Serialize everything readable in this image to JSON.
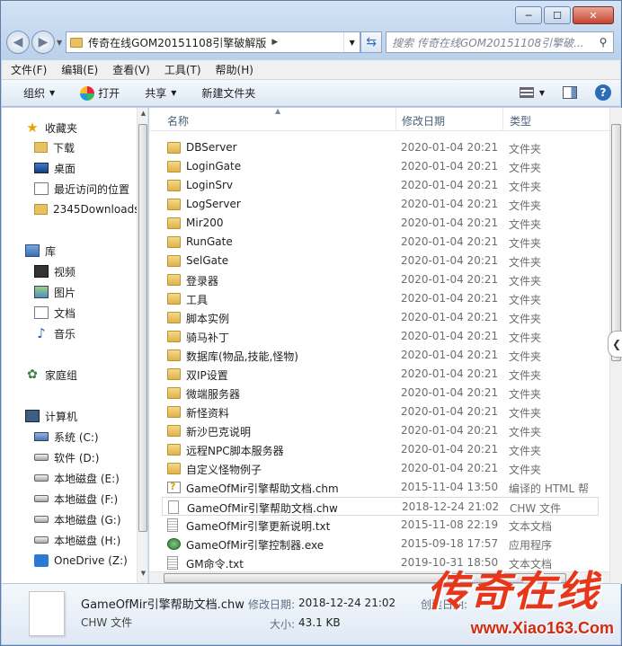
{
  "window": {
    "minimize_label": "─",
    "maximize_label": "☐",
    "close_label": "✕"
  },
  "address": {
    "path_segment": "传奇在线GOM20151108引擎破解版",
    "search_placeholder": "搜索 传奇在线GOM20151108引擎破..."
  },
  "menubar": [
    "文件(F)",
    "编辑(E)",
    "查看(V)",
    "工具(T)",
    "帮助(H)"
  ],
  "toolbar": {
    "organize": "组织",
    "open": "打开",
    "share": "共享",
    "new_folder": "新建文件夹"
  },
  "nav": {
    "favorites": "收藏夹",
    "downloads": "下载",
    "desktop": "桌面",
    "recent": "最近访问的位置",
    "folder_2345": "2345Downloads",
    "libraries": "库",
    "videos": "视频",
    "pictures": "图片",
    "documents": "文档",
    "music": "音乐",
    "homegroup": "家庭组",
    "computer": "计算机",
    "drives": [
      "系统 (C:)",
      "软件 (D:)",
      "本地磁盘 (E:)",
      "本地磁盘 (F:)",
      "本地磁盘 (G:)",
      "本地磁盘 (H:)",
      "OneDrive (Z:)"
    ]
  },
  "columns": {
    "name": "名称",
    "date": "修改日期",
    "type": "类型"
  },
  "files": [
    {
      "name": "DBServer",
      "date": "2020-01-04 20:21",
      "type": "文件夹",
      "icon": "folder-icon"
    },
    {
      "name": "LoginGate",
      "date": "2020-01-04 20:21",
      "type": "文件夹",
      "icon": "folder-icon"
    },
    {
      "name": "LoginSrv",
      "date": "2020-01-04 20:21",
      "type": "文件夹",
      "icon": "folder-icon"
    },
    {
      "name": "LogServer",
      "date": "2020-01-04 20:21",
      "type": "文件夹",
      "icon": "folder-icon"
    },
    {
      "name": "Mir200",
      "date": "2020-01-04 20:21",
      "type": "文件夹",
      "icon": "folder-icon"
    },
    {
      "name": "RunGate",
      "date": "2020-01-04 20:21",
      "type": "文件夹",
      "icon": "folder-icon"
    },
    {
      "name": "SelGate",
      "date": "2020-01-04 20:21",
      "type": "文件夹",
      "icon": "folder-icon"
    },
    {
      "name": "登录器",
      "date": "2020-01-04 20:21",
      "type": "文件夹",
      "icon": "folder-icon"
    },
    {
      "name": "工具",
      "date": "2020-01-04 20:21",
      "type": "文件夹",
      "icon": "folder-icon"
    },
    {
      "name": "脚本实例",
      "date": "2020-01-04 20:21",
      "type": "文件夹",
      "icon": "folder-icon"
    },
    {
      "name": "骑马补丁",
      "date": "2020-01-04 20:21",
      "type": "文件夹",
      "icon": "folder-icon"
    },
    {
      "name": "数据库(物品,技能,怪物)",
      "date": "2020-01-04 20:21",
      "type": "文件夹",
      "icon": "folder-icon"
    },
    {
      "name": "双IP设置",
      "date": "2020-01-04 20:21",
      "type": "文件夹",
      "icon": "folder-icon"
    },
    {
      "name": "微端服务器",
      "date": "2020-01-04 20:21",
      "type": "文件夹",
      "icon": "folder-icon"
    },
    {
      "name": "新怪资料",
      "date": "2020-01-04 20:21",
      "type": "文件夹",
      "icon": "folder-icon"
    },
    {
      "name": "新沙巴克说明",
      "date": "2020-01-04 20:21",
      "type": "文件夹",
      "icon": "folder-icon"
    },
    {
      "name": "远程NPC脚本服务器",
      "date": "2020-01-04 20:21",
      "type": "文件夹",
      "icon": "folder-icon"
    },
    {
      "name": "自定义怪物例子",
      "date": "2020-01-04 20:21",
      "type": "文件夹",
      "icon": "folder-icon"
    },
    {
      "name": "GameOfMir引擎帮助文档.chm",
      "date": "2015-11-04 13:50",
      "type": "编译的 HTML 帮",
      "icon": "chm-icon"
    },
    {
      "name": "GameOfMir引擎帮助文档.chw",
      "date": "2018-12-24 21:02",
      "type": "CHW 文件",
      "icon": "file-icon",
      "selected": true
    },
    {
      "name": "GameOfMir引擎更新说明.txt",
      "date": "2015-11-08 22:19",
      "type": "文本文档",
      "icon": "text-file-icon"
    },
    {
      "name": "GameOfMir引擎控制器.exe",
      "date": "2015-09-18 17:57",
      "type": "应用程序",
      "icon": "exe-icon"
    },
    {
      "name": "GM命令.txt",
      "date": "2019-10-31 18:50",
      "type": "文本文档",
      "icon": "text-file-icon"
    }
  ],
  "details": {
    "name": "GameOfMir引擎帮助文档.chw",
    "type": "CHW 文件",
    "modified_label": "修改日期:",
    "modified_value": "2018-12-24 21:02",
    "created_label": "创建日期:",
    "size_label": "大小:",
    "size_value": "43.1 KB"
  },
  "watermark": {
    "title": "传奇在线",
    "url": "www.Xiao163.Com"
  }
}
